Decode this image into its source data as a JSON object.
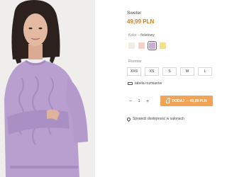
{
  "product": {
    "name": "Sweter",
    "price": "49,99 PLN"
  },
  "color": {
    "label": "Kolor",
    "separator": " – ",
    "selected_name": "fioletowy",
    "swatches": [
      {
        "hex": "#f1ece4",
        "selected": false
      },
      {
        "hex": "#f3d2cb",
        "selected": false
      },
      {
        "hex": "#c6aed4",
        "selected": true
      },
      {
        "hex": "#f6df8a",
        "selected": false
      }
    ]
  },
  "size": {
    "label": "Rozmiar",
    "options": [
      "XXS",
      "XS",
      "S",
      "M",
      "L"
    ]
  },
  "size_table_link": "tabela rozmiarów",
  "quantity": {
    "minus": "−",
    "value": "1",
    "plus": "+"
  },
  "add_button": {
    "label": "DODAJ",
    "separator": " - ",
    "price": "49,99 PLN"
  },
  "store_availability_link": "Sprawdź dostępność w salonach",
  "colors": {
    "accent": "#f2a356",
    "price": "#cf7f22",
    "photo_background": "#efeeec",
    "sweater": "#b99fd0"
  }
}
